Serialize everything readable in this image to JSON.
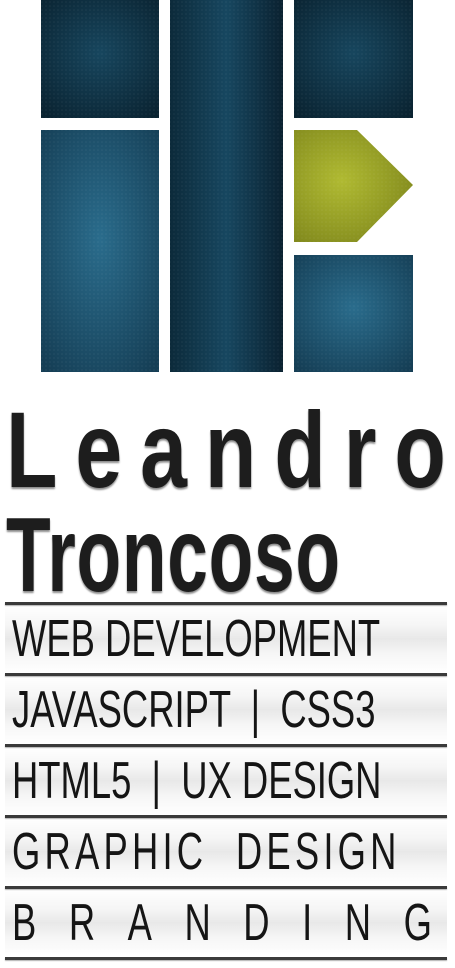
{
  "logo": {
    "colors": {
      "dark_teal": "#0f3447",
      "mid_teal": "#1f5874",
      "accent_olive": "#9ca62a",
      "gap": "#ffffff"
    }
  },
  "name": {
    "first": "Leandro",
    "first_letters": [
      "L",
      "e",
      "a",
      "n",
      "d",
      "r",
      "o"
    ],
    "last": "Troncoso"
  },
  "skills": [
    {
      "label": "WEB DEVELOPMENT"
    },
    {
      "label": "JAVASCRIPT  |  CSS3"
    },
    {
      "label": "HTML5  |  UX DESIGN"
    },
    {
      "label": "GRAPHIC  DESIGN"
    },
    {
      "label": "BRANDING",
      "letters": [
        "B",
        "R",
        "A",
        "N",
        "D",
        "I",
        "N",
        "G"
      ]
    }
  ]
}
